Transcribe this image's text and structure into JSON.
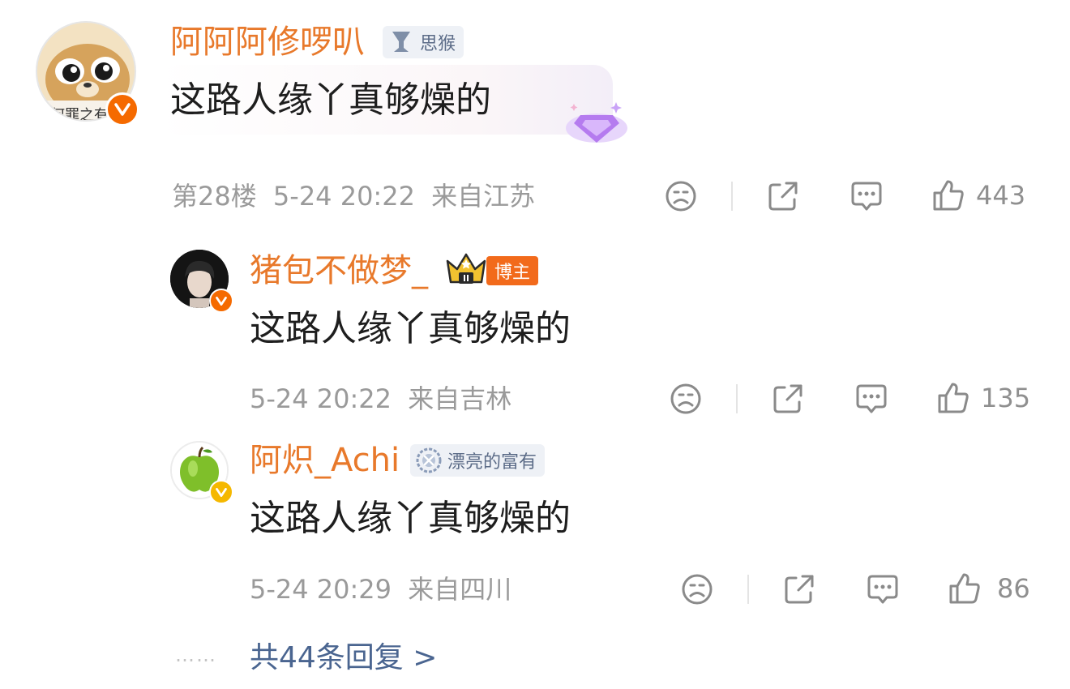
{
  "comment": {
    "username": "阿阿阿修啰叭",
    "badge": "思猴",
    "text": "这路人缘丫真够燥的",
    "avatar_text": "何罪之有",
    "floor": "第28楼",
    "time": "5-24 20:22",
    "location": "来自江苏",
    "likes": "443"
  },
  "replies": [
    {
      "username": "猪包不做梦_",
      "badge": "博主",
      "text": "这路人缘丫真够燥的",
      "time": "5-24 20:22",
      "location": "来自吉林",
      "likes": "135"
    },
    {
      "username": "阿炽_Achi",
      "badge": "漂亮的富有",
      "text": "这路人缘丫真够燥的",
      "time": "5-24 20:29",
      "location": "来自四川",
      "likes": "86"
    }
  ],
  "more": {
    "dots": "……",
    "label": "共44条回复 >"
  },
  "colors": {
    "username": "#e8792b",
    "verified": "#f56a00",
    "verified_gold": "#f5b800",
    "link": "#4a6590",
    "meta": "#9a9a9a"
  },
  "icons": {
    "dislike": "sad-face-icon",
    "share": "share-icon",
    "comment": "comment-icon",
    "like": "thumbs-up-icon"
  }
}
